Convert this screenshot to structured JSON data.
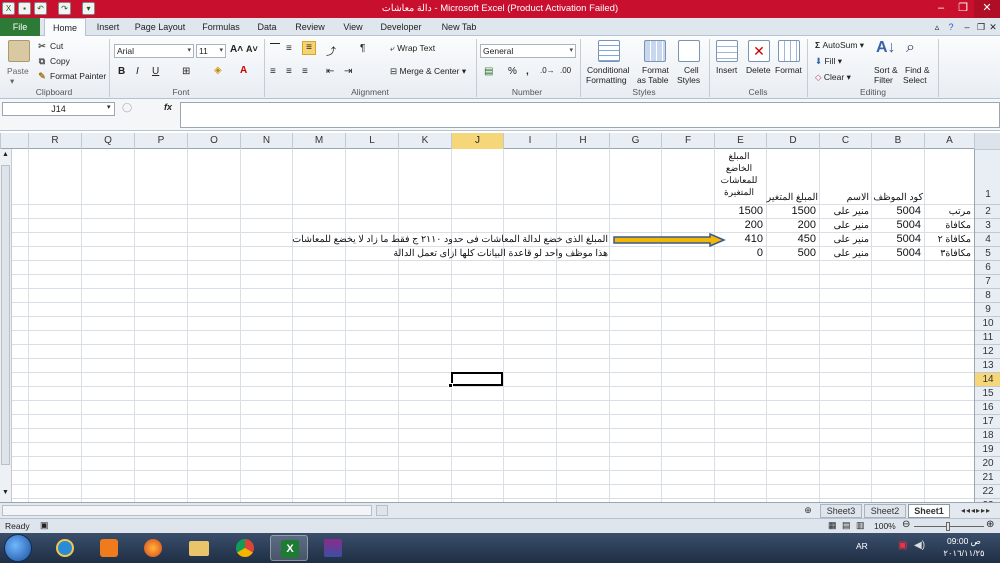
{
  "window": {
    "title": "دالة معاشات  -  Microsoft Excel (Product Activation Failed)",
    "title_color": "#c8102e"
  },
  "tabs": [
    {
      "label": "File"
    },
    {
      "label": "Home"
    },
    {
      "label": "Insert"
    },
    {
      "label": "Page Layout"
    },
    {
      "label": "Formulas"
    },
    {
      "label": "Data"
    },
    {
      "label": "Review"
    },
    {
      "label": "View"
    },
    {
      "label": "Developer"
    },
    {
      "label": "New Tab"
    }
  ],
  "ribbon": {
    "clipboard": {
      "label": "Clipboard",
      "paste": "Paste",
      "cut": "Cut",
      "copy": "Copy",
      "format_painter": "Format Painter"
    },
    "font": {
      "label": "Font",
      "name": "Arial",
      "size": "11"
    },
    "alignment": {
      "label": "Alignment",
      "wrap": "Wrap Text",
      "merge": "Merge & Center"
    },
    "number": {
      "label": "Number",
      "format": "General"
    },
    "styles": {
      "label": "Styles",
      "conditional": "Conditional",
      "conditional2": "Formatting",
      "format_as": "Format",
      "format_as2": "as Table",
      "cell_styles": "Cell",
      "cell_styles2": "Styles"
    },
    "cells": {
      "label": "Cells",
      "insert": "Insert",
      "delete": "Delete",
      "format": "Format"
    },
    "editing": {
      "label": "Editing",
      "autosum": "AutoSum",
      "fill": "Fill",
      "clear": "Clear",
      "sort": "Sort &",
      "sort2": "Filter",
      "find": "Find &",
      "find2": "Select"
    }
  },
  "formula_bar": {
    "name_box": "J14",
    "fx": "fx",
    "value": ""
  },
  "columns": [
    "R",
    "Q",
    "P",
    "O",
    "N",
    "M",
    "L",
    "K",
    "J",
    "I",
    "H",
    "G",
    "F",
    "E",
    "D",
    "C",
    "B",
    "A"
  ],
  "active_column": "J",
  "active_row": "14",
  "rows": [
    "1",
    "2",
    "3",
    "4",
    "5",
    "6",
    "7",
    "8",
    "9",
    "10",
    "11",
    "12",
    "13",
    "14",
    "15",
    "16",
    "17",
    "18",
    "19",
    "20",
    "21",
    "22",
    "23"
  ],
  "sheet": {
    "headers": {
      "A": "",
      "B": "كود الموظف",
      "C": "الاسم",
      "D": "المبلغ المتغير",
      "E_lines": [
        "المبلغ",
        "الخاضع",
        "للمعاشات",
        "المتغيرة"
      ]
    },
    "data_rows": [
      {
        "A": "مرتب",
        "B": "5004",
        "C": "منير على",
        "D": "1500",
        "E": "1500"
      },
      {
        "A": "مكافاة",
        "B": "5004",
        "C": "منير على",
        "D": "200",
        "E": "200"
      },
      {
        "A": "مكافاة ٢",
        "B": "5004",
        "C": "منير على",
        "D": "450",
        "E": "410"
      },
      {
        "A": "مكافاة٣",
        "B": "5004",
        "C": "منير على",
        "D": "500",
        "E": "0"
      }
    ],
    "note_line1": "المبلغ الذى خضع لدالة المعاشات فى حدود ٢١١٠ ج فقط ما زاد لا يخضع للمعاشات",
    "note_line2": "هذا موظف واحد لو قاعدة البيانات كلها ازاى تعمل الدالة"
  },
  "sheet_tabs": [
    {
      "label": "Sheet3"
    },
    {
      "label": "Sheet2"
    },
    {
      "label": "Sheet1"
    }
  ],
  "status": {
    "ready": "Ready",
    "zoom": "100%"
  },
  "taskbar": {
    "lang": "AR",
    "time": "09:00 ص",
    "date": "٢٠١٦/١١/٢٥"
  }
}
